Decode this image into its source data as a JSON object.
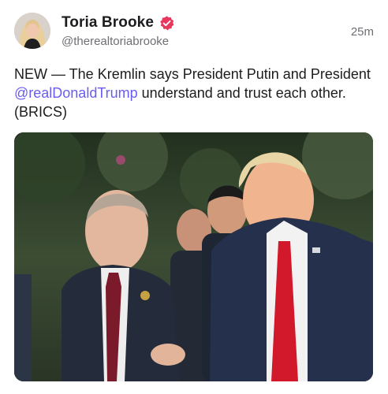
{
  "post": {
    "author_name": "Toria Brooke",
    "handle": "@therealtoriabrooke",
    "timestamp": "25m",
    "text_before": "NEW — The Kremlin says President Putin and President ",
    "mention": "@realDonaldTrump",
    "text_after": " understand and trust each other. (BRICS)",
    "verified_icon": "verified-badge-icon",
    "colors": {
      "mention": "#6a5cf0",
      "verified": "#e8365d",
      "muted": "#6e6e73"
    }
  }
}
